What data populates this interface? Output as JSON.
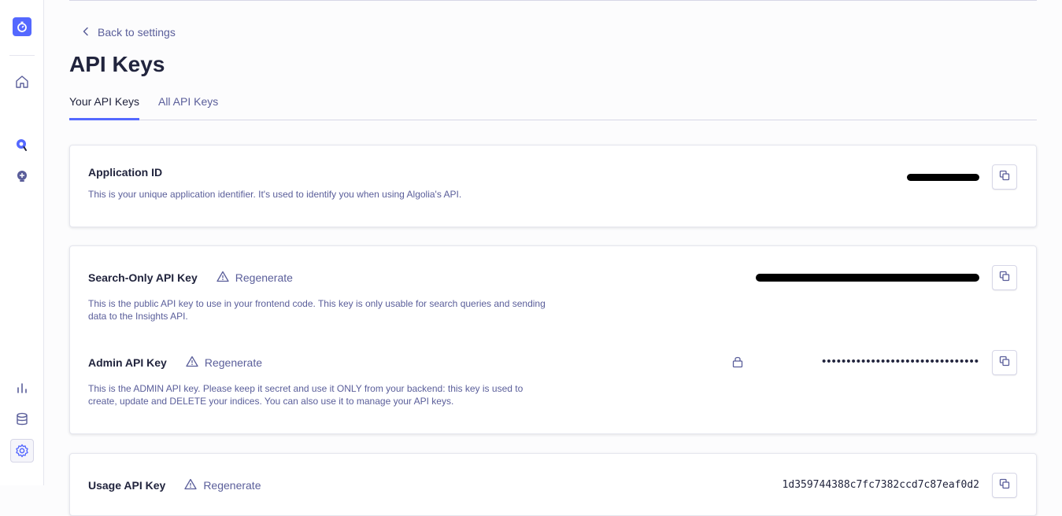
{
  "nav": {
    "back_label": "Back to settings",
    "page_title": "API Keys"
  },
  "tabs": [
    {
      "label": "Your API Keys",
      "active": true
    },
    {
      "label": "All API Keys",
      "active": false
    }
  ],
  "keys": {
    "application_id": {
      "title": "Application ID",
      "description": "This is your unique application identifier. It's used to identify you when using Algolia's API."
    },
    "search_only": {
      "title": "Search-Only API Key",
      "regenerate_label": "Regenerate",
      "description": "This is the public API key to use in your frontend code. This key is only usable for search queries and sending data to the Insights API."
    },
    "admin": {
      "title": "Admin API Key",
      "regenerate_label": "Regenerate",
      "masked_value": "••••••••••••••••••••••••••••••••",
      "description": "This is the ADMIN API key. Please keep it secret and use it ONLY from your backend: this key is used to create, update and DELETE your indices. You can also use it to manage your API keys."
    },
    "usage": {
      "title": "Usage API Key",
      "regenerate_label": "Regenerate",
      "value": "1d359744388c7fc7382ccd7c87eaf0d2"
    }
  },
  "colors": {
    "accent": "#5468ff",
    "text_primary": "#21243d",
    "text_secondary": "#5a5e9a",
    "border": "#d6d6e7"
  },
  "icons": [
    "logo-stopwatch-icon",
    "home-icon",
    "search-icon",
    "bulb-icon",
    "bar-chart-icon",
    "database-icon",
    "gear-icon",
    "chevron-left-icon",
    "warning-icon",
    "lock-icon",
    "copy-icon"
  ]
}
